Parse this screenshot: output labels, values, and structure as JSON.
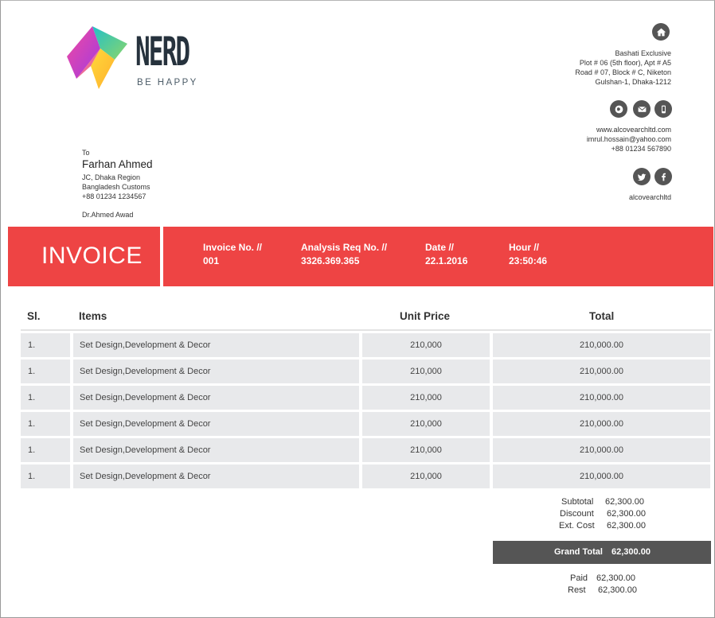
{
  "brand": {
    "name": "NERD",
    "tagline": "BE HAPPY"
  },
  "company": {
    "address_lines": [
      "Bashati Exclusive",
      "Plot # 06 (5th floor), Apt # A5",
      "Road # 07, Block # C, Niketon",
      "Gulshan-1, Dhaka-1212"
    ],
    "contact_lines": [
      "www.alcovearchltd.com",
      "imrul.hossain@yahoo.com",
      "+88 01234 567890"
    ],
    "social_handle": "alcovearchltd"
  },
  "icons": [
    "home-icon",
    "globe-icon",
    "mail-icon",
    "phone-icon",
    "twitter-icon",
    "facebook-icon"
  ],
  "recipient": {
    "label": "To",
    "name": "Farhan Ahmed",
    "lines": [
      "JC, Dhaka Region",
      "Bangladesh Customs",
      "+88 01234 1234567"
    ],
    "signatory": "Dr.Ahmed Awad"
  },
  "banner": {
    "title": "INVOICE",
    "color": "#ee4444",
    "fields": [
      {
        "label": "Invoice No. //",
        "value": "001"
      },
      {
        "label": "Analysis Req No. //",
        "value": "3326.369.365"
      },
      {
        "label": "Date //",
        "value": "22.1.2016"
      },
      {
        "label": "Hour //",
        "value": "23:50:46"
      }
    ]
  },
  "table": {
    "headers": [
      "Sl.",
      "Items",
      "Unit Price",
      "Total"
    ],
    "rows": [
      {
        "sl": "1.",
        "item": "Set Design,Development & Decor",
        "unit_price": "210,000",
        "total": "210,000.00"
      },
      {
        "sl": "1.",
        "item": "Set Design,Development & Decor",
        "unit_price": "210,000",
        "total": "210,000.00"
      },
      {
        "sl": "1.",
        "item": "Set Design,Development & Decor",
        "unit_price": "210,000",
        "total": "210,000.00"
      },
      {
        "sl": "1.",
        "item": "Set Design,Development & Decor",
        "unit_price": "210,000",
        "total": "210,000.00"
      },
      {
        "sl": "1.",
        "item": "Set Design,Development & Decor",
        "unit_price": "210,000",
        "total": "210,000.00"
      },
      {
        "sl": "1.",
        "item": "Set Design,Development & Decor",
        "unit_price": "210,000",
        "total": "210,000.00"
      }
    ]
  },
  "summary": {
    "subtotal": {
      "label": "Subtotal",
      "value": "62,300.00"
    },
    "discount": {
      "label": "Discount",
      "value": "62,300.00"
    },
    "ext_cost": {
      "label": "Ext. Cost",
      "value": "62,300.00"
    },
    "grand_total": {
      "label": "Grand Total",
      "value": "62,300.00",
      "color": "#555555"
    },
    "paid": {
      "label": "Paid",
      "value": "62,300.00"
    },
    "rest": {
      "label": "Rest",
      "value": "62,300.00"
    }
  }
}
